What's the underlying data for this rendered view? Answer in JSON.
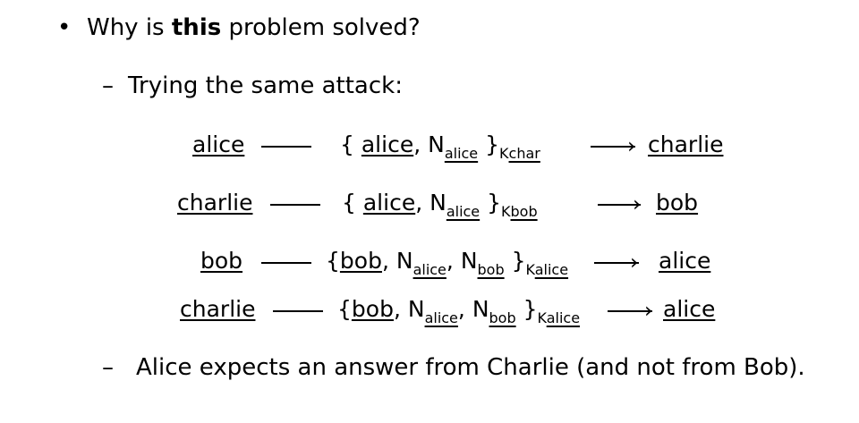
{
  "bullet1": {
    "marker": "•",
    "prefix": "Why is ",
    "emph": "this",
    "suffix": " problem solved?"
  },
  "sub1": {
    "marker": "–",
    "text": "Trying the same attack:"
  },
  "rows": [
    {
      "from": "alice",
      "open": "{ ",
      "m1": "alice",
      "sep1": ", ",
      "n1": "N",
      "n1sub": "alice",
      "close": " }",
      "key": "K",
      "keysub": "char",
      "to": "charlie"
    },
    {
      "from": "charlie",
      "open": "{ ",
      "m1": "alice",
      "sep1": ", ",
      "n1": "N",
      "n1sub": "alice",
      "close": " }",
      "key": "K",
      "keysub": "bob",
      "to": "bob"
    },
    {
      "from": "bob",
      "open": "{",
      "m1": "bob",
      "sep1": ", ",
      "n1": "N",
      "n1sub": "alice",
      "sep2": ", ",
      "n2": "N",
      "n2sub": "bob",
      "close": " }",
      "key": "K",
      "keysub": "alice",
      "to": "alice"
    },
    {
      "from": "charlie",
      "open": "{",
      "m1": "bob",
      "sep1": ", ",
      "n1": "N",
      "n1sub": "alice",
      "sep2": ", ",
      "n2": "N",
      "n2sub": "bob",
      "close": " }",
      "key": "K",
      "keysub": "alice",
      "to": "alice"
    }
  ],
  "sub2": {
    "marker": "–",
    "text": "Alice expects an answer from Charlie (and not from Bob)."
  }
}
